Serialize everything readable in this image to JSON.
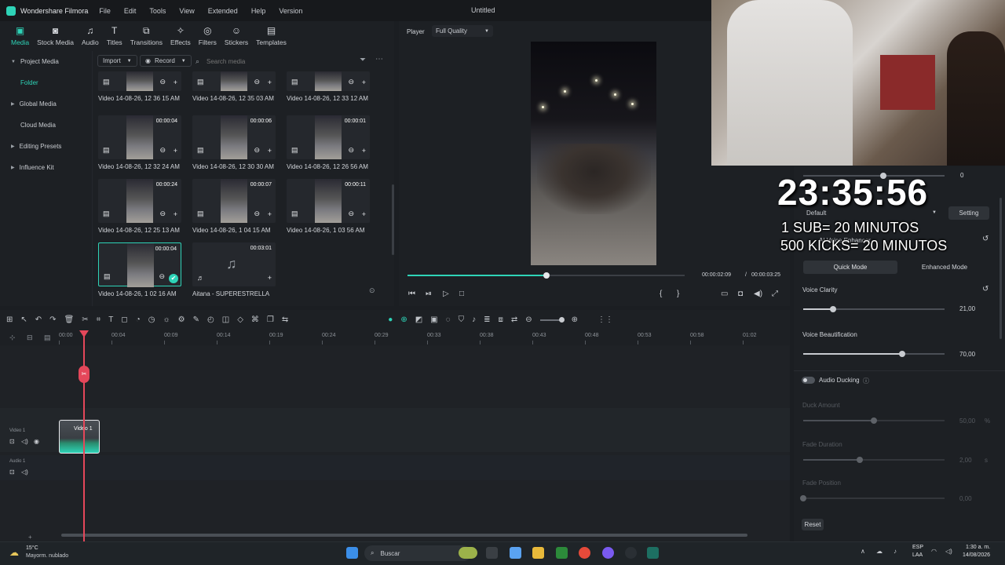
{
  "menubar": {
    "app": "Wondershare Filmora",
    "items": [
      "File",
      "Edit",
      "Tools",
      "View",
      "Extended",
      "Help",
      "Version"
    ],
    "title": "Untitled"
  },
  "toolbar": {
    "items": [
      {
        "label": "Media",
        "icon": "media-icon"
      },
      {
        "label": "Stock Media",
        "icon": "stock-media-icon"
      },
      {
        "label": "Audio",
        "icon": "audio-icon"
      },
      {
        "label": "Titles",
        "icon": "titles-icon"
      },
      {
        "label": "Transitions",
        "icon": "transitions-icon"
      },
      {
        "label": "Effects",
        "icon": "effects-icon"
      },
      {
        "label": "Filters",
        "icon": "filters-icon"
      },
      {
        "label": "Stickers",
        "icon": "stickers-icon"
      },
      {
        "label": "Templates",
        "icon": "templates-icon"
      }
    ]
  },
  "leftnav": {
    "project_media": "Project Media",
    "folder": "Folder",
    "global_media": "Global Media",
    "cloud_media": "Cloud Media",
    "editing_presets": "Editing Presets",
    "influence_kit": "Influence Kit"
  },
  "media_toolbar": {
    "import": "Import",
    "record": "Record",
    "search_placeholder": "Search media"
  },
  "media_items": [
    {
      "name": "Video 14-08-26, 12 36 15 AM",
      "duration": ""
    },
    {
      "name": "Video 14-08-26, 12 35 03 AM",
      "duration": ""
    },
    {
      "name": "Video 14-08-26, 12 33 12 AM",
      "duration": ""
    },
    {
      "name": "Video 14-08-26, 12 32 24 AM",
      "duration": "00:00:04"
    },
    {
      "name": "Video 14-08-26, 12 30 30 AM",
      "duration": "00:00:06"
    },
    {
      "name": "Video 14-08-26, 12 26 56 AM",
      "duration": "00:00:01"
    },
    {
      "name": "Video 14-08-26, 12 25 13 AM",
      "duration": "00:00:24"
    },
    {
      "name": "Video 14-08-26, 1 04 15 AM",
      "duration": "00:00:07"
    },
    {
      "name": "Video 14-08-26, 1 03 56 AM",
      "duration": "00:00:11"
    },
    {
      "name": "Video 14-08-26, 1 02 16 AM",
      "duration": "00:00:04"
    },
    {
      "name": "Aitana - SUPERESTRELLA",
      "duration": "00:03:01"
    }
  ],
  "player": {
    "label": "Player",
    "quality": "Full Quality",
    "current": "00:00:02:09",
    "separator": "/",
    "total": "00:00:03:25",
    "progress": 0.5
  },
  "ruler": {
    "ticks": [
      "00:00",
      "00:04",
      "00:09",
      "00:14",
      "00:19",
      "00:24",
      "00:29",
      "00:33",
      "00:38",
      "00:43",
      "00:48",
      "00:53",
      "00:58",
      "01:02"
    ]
  },
  "tracks": {
    "video1": "Video 1",
    "audio1": "Audio 1",
    "clip_label": "Video 1"
  },
  "rpanel": {
    "top_value": "0",
    "preset_label": "Default",
    "setting": "Setting",
    "ai_voice_enhancer": "AI Voice Enhancer",
    "quick_mode": "Quick Mode",
    "enhanced_mode": "Enhanced Mode",
    "voice_clarity": "Voice Clarity",
    "voice_clarity_val": "21,00",
    "voice_clarity_pct": 0.21,
    "voice_beautification": "Voice Beautification",
    "voice_beautification_val": "70,00",
    "voice_beautification_pct": 0.7,
    "audio_ducking": "Audio Ducking",
    "duck_amount": "Duck Amount",
    "duck_amount_val": "50,00",
    "duck_amount_unit": "%",
    "duck_amount_pct": 0.5,
    "fade_duration": "Fade Duration",
    "fade_duration_val": "2,00",
    "fade_duration_unit": "s",
    "fade_duration_pct": 0.4,
    "fade_position": "Fade Position",
    "fade_position_val": "0,00",
    "fade_position_pct": 0.0,
    "reset": "Reset"
  },
  "overlay": {
    "clock": "23:35:56",
    "line1": "1 SUB= 20 MINUTOS",
    "line2": "500 KICKS= 20 MINUTOS"
  },
  "taskbar": {
    "temp": "15°C",
    "weather": "Mayorm. nublado",
    "search": "Buscar",
    "lang1": "ESP",
    "lang2": "LAA",
    "time": "1:30 a. m.",
    "date": "14/08/2026"
  }
}
